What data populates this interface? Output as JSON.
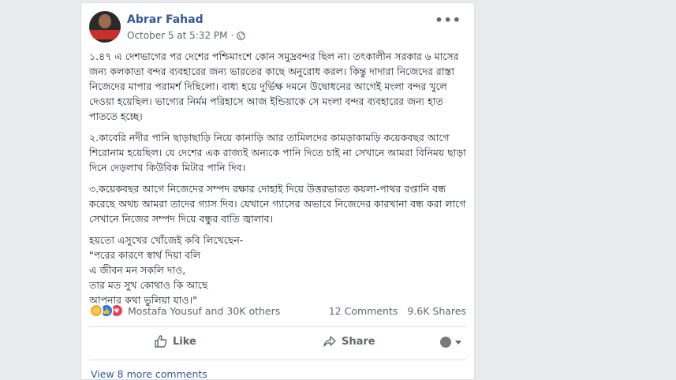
{
  "post": {
    "author": "Abrar Fahad",
    "timestamp": "October 5 at 5:32 PM",
    "separator": "·",
    "options_icon": "•••",
    "paragraphs": [
      "১.৪৭ এ দেশভাগের পর দেশের পশ্চিমাংশে কোন সমুদ্রবন্দর ছিল না। তৎকালীন সরকার ৬ মাসের জন্য কলকাতা বন্দর ব্যবহারের জন্য ভারতের কাছে অনুরোধ করল। কিন্তু দাদারা নিজেদের রাস্তা নিজেদের মাপার পরামর্শ দিছিলো। বাধ্য হয়ে দুর্ভিক্ষ দমনে উদ্বোধনের আগেই মংলা বন্দর খুলে দেওয়া হয়েছিল। ভাগ্যের নির্মম পরিহাসে আজ ইন্ডিয়াকে সে মংলা বন্দর ব্যবহারের জন্য হাত পাততে হচ্ছে।",
      "২.কাবেরি নদীর পানি ছাড়াছাড়ি নিয়ে কানাড়ি আর তামিলদের কামড়াকামড়ি কয়েকবছর আগে শিরোনাম হয়েছিল। যে দেশের এক রাজ্যই অন্যকে পানি দিতে চাই না সেখানে আমরা বিনিময় ছাড়া দিনে দেড়লাখ কিউবিক মিটার পানি দিব।",
      "৩.কয়েকবছর আগে নিজেদের সম্পদ রক্ষার দোহাই দিয়ে উত্তরভারত কয়লা-পাথর রপ্তানি বন্ধ করেছে অথচ আমরা তাদের গ্যাস দিব। যেখানে গ্যাসের অভাবে নিজেদের কারখানা বন্ধ করা লাগে সেখানে নিজের সম্পদ দিয়ে বন্ধুর বাতি জ্বালাব।"
    ],
    "poem_intro": "হয়তো এসুখের খোঁজেই কবি লিখেছেন-",
    "poem_lines": [
      "\"পরের কারণে স্বার্থ দিয়া বলি",
      "এ জীবন মন সকলি দাও,",
      "তার মত সুখ কোথাও কি আছে",
      "আপনার কথা ভুলিয়া যাও।\""
    ]
  },
  "stats": {
    "reactors": "Mostafa Yousuf and 30K others",
    "comments": "12 Comments",
    "shares": "9.6K Shares",
    "reaction_icons": [
      "sad-icon",
      "like-icon",
      "love-icon"
    ]
  },
  "actions": {
    "like_label": "Like",
    "share_label": "Share"
  },
  "comments": {
    "view_more": "View 8 more comments"
  },
  "colors": {
    "author": "#365899",
    "like": "#2078f4",
    "love": "#f33e58",
    "sad": "#f7b125",
    "link": "#385898"
  }
}
